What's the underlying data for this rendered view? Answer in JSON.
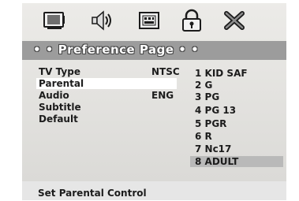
{
  "icons": [
    {
      "name": "tv-screen-icon"
    },
    {
      "name": "audio-speaker-icon"
    },
    {
      "name": "video-settings-icon"
    },
    {
      "name": "lock-icon"
    },
    {
      "name": "tools-icon"
    }
  ],
  "title": "• • Preference Page • •",
  "menu": [
    {
      "label": "TV Type",
      "value": "NTSC"
    },
    {
      "label": "Parental",
      "value": ""
    },
    {
      "label": "Audio",
      "value": "ENG"
    },
    {
      "label": "Subtitle",
      "value": ""
    },
    {
      "label": "Default",
      "value": ""
    }
  ],
  "selected_menu_index": 1,
  "options": [
    "1 KID SAF",
    "2 G",
    "3 PG",
    "4 PG 13",
    "5 PGR",
    "6 R",
    "7 Nc17",
    "8 ADULT"
  ],
  "selected_option_index": 7,
  "status": "Set Parental Control",
  "colors": {
    "title_bar": "#9c9c9c",
    "highlight_option": "#b9b9b9",
    "panel": "#dddcd9"
  }
}
